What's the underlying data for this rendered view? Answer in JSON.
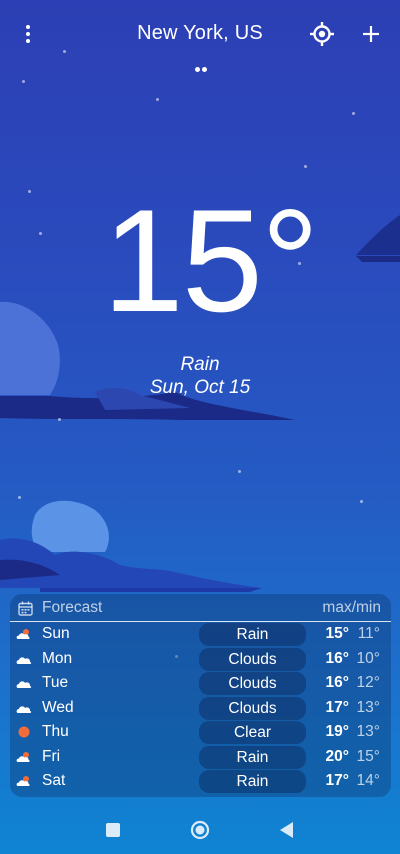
{
  "header": {
    "city": "New York, US"
  },
  "current": {
    "temperature": "15°",
    "condition": "Rain",
    "date": "Sun, Oct 15"
  },
  "forecast": {
    "title": "Forecast",
    "maxmin_label": "max/min",
    "days": [
      {
        "day": "Sun",
        "condition": "Rain",
        "max": "15°",
        "min": "11°",
        "icon": "cloud-rain-icon"
      },
      {
        "day": "Mon",
        "condition": "Clouds",
        "max": "16°",
        "min": "10°",
        "icon": "cloud-icon"
      },
      {
        "day": "Tue",
        "condition": "Clouds",
        "max": "16°",
        "min": "12°",
        "icon": "cloud-icon"
      },
      {
        "day": "Wed",
        "condition": "Clouds",
        "max": "17°",
        "min": "13°",
        "icon": "cloud-icon"
      },
      {
        "day": "Thu",
        "condition": "Clear",
        "max": "19°",
        "min": "13°",
        "icon": "sun-icon"
      },
      {
        "day": "Fri",
        "condition": "Rain",
        "max": "20°",
        "min": "15°",
        "icon": "cloud-rain-icon"
      },
      {
        "day": "Sat",
        "condition": "Rain",
        "max": "17°",
        "min": "14°",
        "icon": "cloud-rain-icon"
      }
    ]
  },
  "colors": {
    "sky_top": "#2c3fb4",
    "sky_bottom": "#0f84d2",
    "sun": "#f26b3a",
    "cloud_light": "#5b93e6",
    "cloud_dark": "#1a2a86"
  }
}
